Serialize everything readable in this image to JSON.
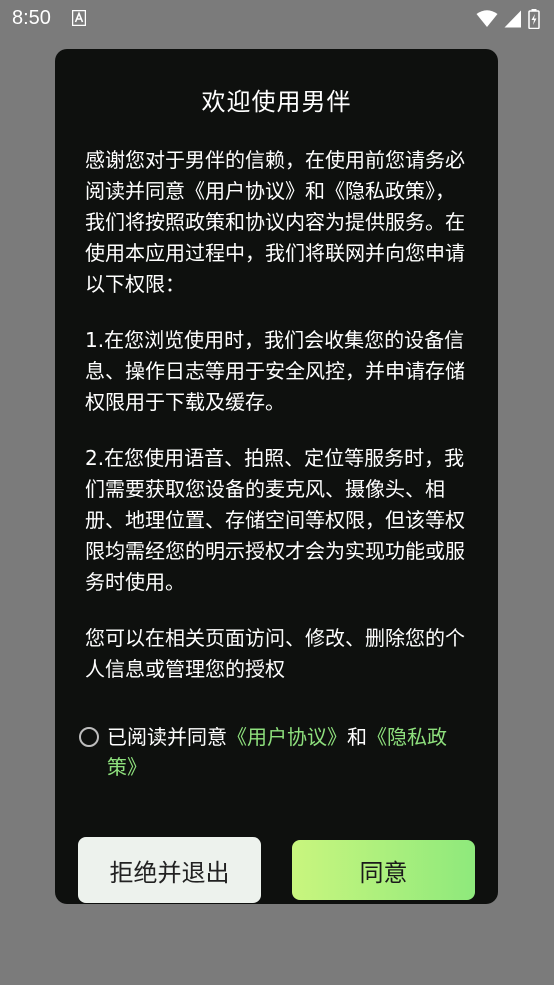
{
  "status_bar": {
    "time": "8:50",
    "icons": [
      "notification-a-icon",
      "wifi-icon",
      "signal-icon",
      "battery-icon"
    ]
  },
  "dialog": {
    "title": "欢迎使用男伴",
    "paragraphs": [
      "感谢您对于男伴的信赖，在使用前您请务必阅读并同意《用户协议》和《隐私政策》，我们将按照政策和协议内容为提供服务。在使用本应用过程中，我们将联网并向您申请以下权限：",
      "1.在您浏览使用时，我们会收集您的设备信息、操作日志等用于安全风控，并申请存储权限用于下载及缓存。",
      "2.在您使用语音、拍照、定位等服务时，我们需要获取您设备的麦克风、摄像头、相册、地理位置、存储空间等权限，但该等权限均需经您的明示授权才会为实现功能或服务时使用。",
      "您可以在相关页面访问、修改、删除您的个人信息或管理您的授权"
    ],
    "consent": {
      "prefix": "已阅读并同意",
      "user_agreement": "《用户协议》",
      "and": "和",
      "privacy_policy": "《隐私政策》",
      "checked": false
    },
    "buttons": {
      "reject": "拒绝并退出",
      "agree": "同意"
    }
  },
  "colors": {
    "dialog_bg": "#0e100e",
    "link": "#8ee07d",
    "agree_gradient_start": "#c9f67e",
    "agree_gradient_end": "#8ee97c",
    "overlay": "#7b7b7b"
  }
}
